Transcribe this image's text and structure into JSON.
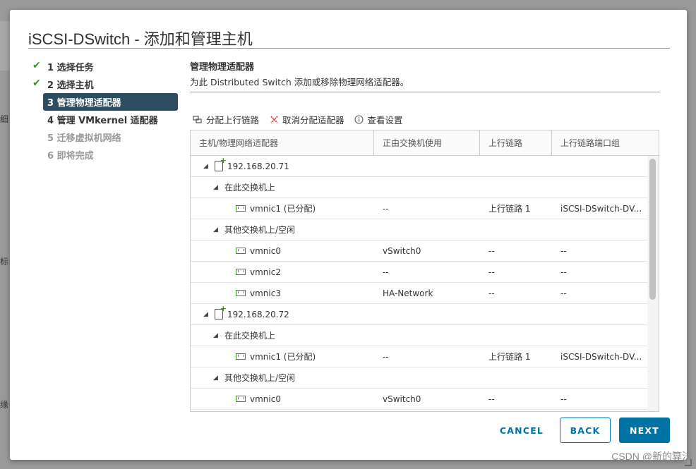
{
  "dialog": {
    "title": "iSCSI-DSwitch - 添加和管理主机"
  },
  "steps": [
    {
      "label": "1 选择任务",
      "state": "done"
    },
    {
      "label": "2 选择主机",
      "state": "done"
    },
    {
      "label": "3 管理物理适配器",
      "state": "active"
    },
    {
      "label": "4 管理 VMkernel 适配器",
      "state": "plain"
    },
    {
      "label": "5 迁移虚拟机网络",
      "state": "pending"
    },
    {
      "label": "6 即将完成",
      "state": "pending"
    }
  ],
  "section": {
    "title": "管理物理适配器",
    "description": "为此 Distributed Switch 添加或移除物理网络适配器。"
  },
  "toolbar": {
    "assign_uplink": "分配上行链路",
    "unassign": "取消分配适配器",
    "view_settings": "查看设置"
  },
  "grid": {
    "headers": [
      "主机/物理网络适配器",
      "正由交换机使用",
      "上行链路",
      "上行链路端口组"
    ],
    "rows": [
      {
        "level": 0,
        "type": "host",
        "name": "192.168.20.71",
        "switch": "",
        "uplink": "",
        "portgroup": ""
      },
      {
        "level": 1,
        "type": "group",
        "name": "在此交换机上",
        "switch": "",
        "uplink": "",
        "portgroup": ""
      },
      {
        "level": 2,
        "type": "nic",
        "name": "vmnic1 (已分配)",
        "switch": "--",
        "uplink": "上行链路 1",
        "portgroup": "iSCSI-DSwitch-DV..."
      },
      {
        "level": 1,
        "type": "group",
        "name": "其他交换机上/空闲",
        "switch": "",
        "uplink": "",
        "portgroup": ""
      },
      {
        "level": 2,
        "type": "nic",
        "name": "vmnic0",
        "switch": "vSwitch0",
        "uplink": "--",
        "portgroup": "--"
      },
      {
        "level": 2,
        "type": "nic",
        "name": "vmnic2",
        "switch": "--",
        "uplink": "--",
        "portgroup": "--"
      },
      {
        "level": 2,
        "type": "nic",
        "name": "vmnic3",
        "switch": "HA-Network",
        "uplink": "--",
        "portgroup": "--"
      },
      {
        "level": 0,
        "type": "host",
        "name": "192.168.20.72",
        "switch": "",
        "uplink": "",
        "portgroup": ""
      },
      {
        "level": 1,
        "type": "group",
        "name": "在此交换机上",
        "switch": "",
        "uplink": "",
        "portgroup": ""
      },
      {
        "level": 2,
        "type": "nic",
        "name": "vmnic1 (已分配)",
        "switch": "--",
        "uplink": "上行链路 1",
        "portgroup": "iSCSI-DSwitch-DV..."
      },
      {
        "level": 1,
        "type": "group",
        "name": "其他交换机上/空闲",
        "switch": "",
        "uplink": "",
        "portgroup": ""
      },
      {
        "level": 2,
        "type": "nic",
        "name": "vmnic0",
        "switch": "vSwitch0",
        "uplink": "--",
        "portgroup": "--"
      }
    ]
  },
  "buttons": {
    "cancel": "CANCEL",
    "back": "BACK",
    "next": "NEXT"
  },
  "background": {
    "fragments": [
      "细",
      "标",
      "缘"
    ]
  },
  "watermark": "CSDN @新的算法",
  "colors": {
    "accent": "#0072a3",
    "active_step": "#2d4c5f",
    "check": "#3c8f1f"
  }
}
